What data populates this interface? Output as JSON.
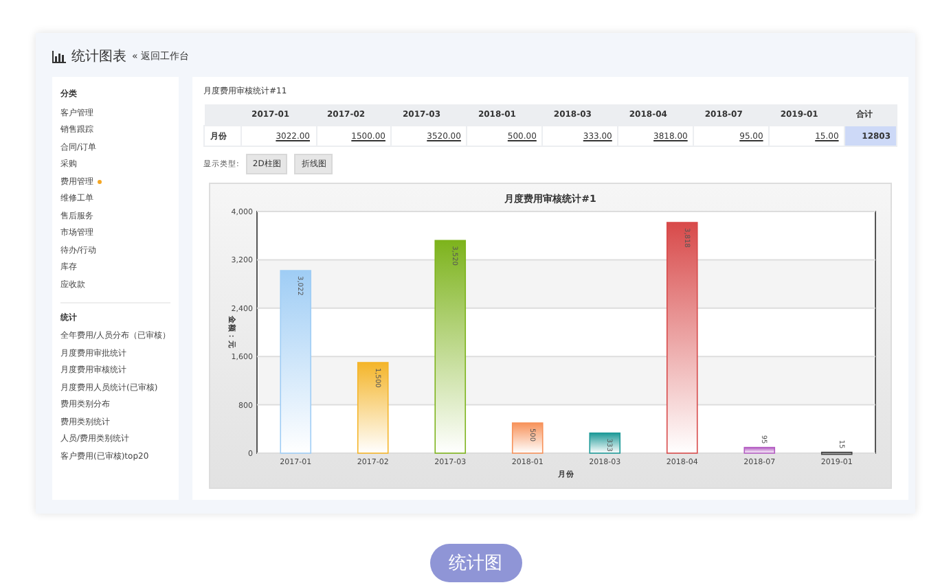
{
  "header": {
    "title": "统计图表",
    "back_link": "« 返回工作台"
  },
  "sidebar": {
    "sections": [
      {
        "heading": "分类",
        "items": [
          {
            "label": "客户管理",
            "flagged": false
          },
          {
            "label": "销售跟踪",
            "flagged": false
          },
          {
            "label": "合同/订单",
            "flagged": false
          },
          {
            "label": "采购",
            "flagged": false
          },
          {
            "label": "费用管理",
            "flagged": true
          },
          {
            "label": "维修工单",
            "flagged": false
          },
          {
            "label": "售后服务",
            "flagged": false
          },
          {
            "label": "市场管理",
            "flagged": false
          },
          {
            "label": "待办/行动",
            "flagged": false
          },
          {
            "label": "库存",
            "flagged": false
          },
          {
            "label": "应收款",
            "flagged": false
          }
        ]
      },
      {
        "heading": "统计",
        "items": [
          {
            "label": "全年费用/人员分布（已审核）",
            "flagged": false
          },
          {
            "label": "月度费用审批统计",
            "flagged": false
          },
          {
            "label": "月度费用审核统计",
            "flagged": false
          },
          {
            "label": "月度费用人员统计(已审核)",
            "flagged": false
          },
          {
            "label": "费用类别分布",
            "flagged": false
          },
          {
            "label": "费用类别统计",
            "flagged": false
          },
          {
            "label": "人员/费用类别统计",
            "flagged": false
          },
          {
            "label": "客户费用(已审核)top20",
            "flagged": false
          }
        ]
      }
    ]
  },
  "report": {
    "title": "月度费用审核统计#11",
    "table": {
      "columns": [
        "2017-01",
        "2017-02",
        "2017-03",
        "2018-01",
        "2018-03",
        "2018-04",
        "2018-07",
        "2019-01",
        "合计"
      ],
      "rows": [
        {
          "label": "月份",
          "cells": [
            "3022.00",
            "1500.00",
            "3520.00",
            "500.00",
            "333.00",
            "3818.00",
            "95.00",
            "15.00"
          ],
          "total": "12803"
        }
      ]
    },
    "display_label": "显示类型:",
    "display_buttons": [
      "2D柱图",
      "折线图"
    ],
    "chart": {
      "chart_data": {
        "type": "bar",
        "title": "月度费用审核统计#1",
        "xlabel": "月份",
        "ylabel": "金额：元",
        "categories": [
          "2017-01",
          "2017-02",
          "2017-03",
          "2018-01",
          "2018-03",
          "2018-04",
          "2018-07",
          "2019-01"
        ],
        "series": [
          {
            "color": "#9fcdf5",
            "values": [
              3022,
              null,
              null,
              null,
              null,
              null,
              null,
              null
            ]
          },
          {
            "color": "#f4b52a",
            "values": [
              null,
              1500,
              null,
              null,
              null,
              null,
              null,
              null
            ]
          },
          {
            "color": "#7db31c",
            "values": [
              null,
              null,
              3520,
              null,
              null,
              null,
              null,
              null
            ]
          },
          {
            "color": "#f7925a",
            "values": [
              null,
              null,
              null,
              500,
              null,
              null,
              null,
              null
            ]
          },
          {
            "color": "#1e9a98",
            "values": [
              null,
              null,
              null,
              null,
              333,
              null,
              null,
              null
            ]
          },
          {
            "color": "#d84a4a",
            "values": [
              null,
              null,
              null,
              null,
              null,
              3818,
              null,
              null
            ]
          },
          {
            "color": "#b35cc2",
            "values": [
              null,
              null,
              null,
              null,
              null,
              null,
              95,
              null
            ]
          },
          {
            "color": "#444444",
            "values": [
              null,
              null,
              null,
              null,
              null,
              null,
              null,
              15
            ]
          }
        ],
        "value_labels": [
          "3,022",
          "1,500",
          "3,520",
          "500",
          "333",
          "3,818",
          "95",
          "15"
        ],
        "grid": true,
        "stacked": true,
        "ylim": [
          0,
          4000
        ],
        "yticks": [
          {
            "value": 0,
            "label": "0"
          },
          {
            "value": 800,
            "label": "800"
          },
          {
            "value": 1600,
            "label": "1,600"
          },
          {
            "value": 2400,
            "label": "2,400"
          },
          {
            "value": 3200,
            "label": "3,200"
          },
          {
            "value": 4000,
            "label": "4,000"
          }
        ]
      }
    }
  },
  "footer_badge": "统计图"
}
